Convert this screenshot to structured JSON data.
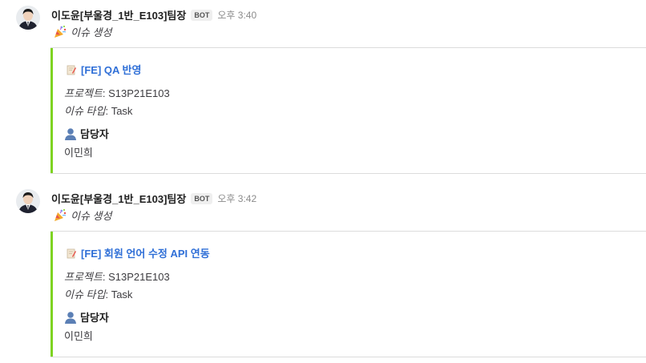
{
  "posts": [
    {
      "username": "이도윤[부울경_1반_E103]팀장",
      "badge": "BOT",
      "time": "오후 3:40",
      "message": "이슈 생성",
      "card": {
        "title": "[FE] QA 반영",
        "project_key": "프로젝트",
        "project_sep": ": ",
        "project_value": "S13P21E103",
        "type_key": "이슈 타입",
        "type_sep": ": ",
        "type_value": "Task",
        "assignee_label": "담당자",
        "assignee_value": "이민희",
        "accent_color": "#7ed321"
      }
    },
    {
      "username": "이도윤[부울경_1반_E103]팀장",
      "badge": "BOT",
      "time": "오후 3:42",
      "message": "이슈 생성",
      "card": {
        "title": "[FE] 회원 언어 수정 API 연동",
        "project_key": "프로젝트",
        "project_sep": ": ",
        "project_value": "S13P21E103",
        "type_key": "이슈 타입",
        "type_sep": ": ",
        "type_value": "Task",
        "assignee_label": "담당자",
        "assignee_value": "이민희",
        "accent_color": "#7ed321"
      }
    }
  ],
  "icons": {
    "avatar": "avatar-photo",
    "message_emoji": "party-popper-icon",
    "card_title": "memo-icon",
    "assignee": "person-icon"
  },
  "colors": {
    "link": "#2f6fd7",
    "accent": "#7ed321"
  }
}
